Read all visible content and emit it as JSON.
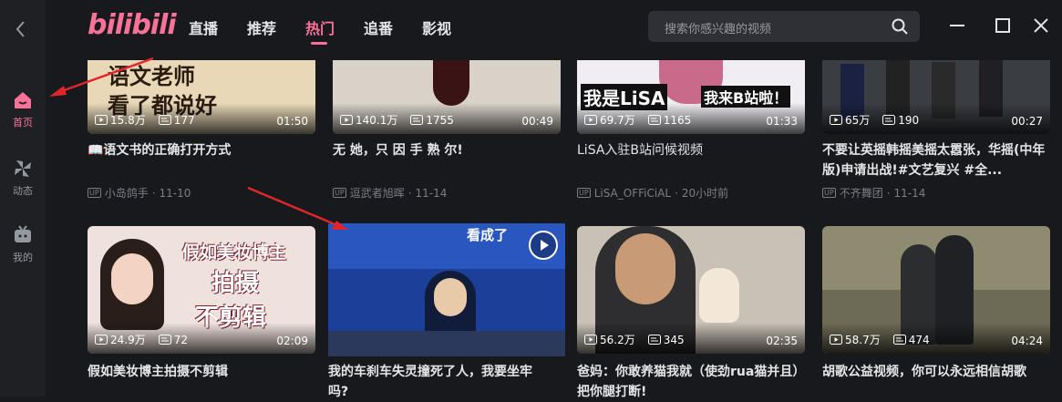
{
  "app": {
    "logo": "bilibili"
  },
  "sidebar": {
    "items": [
      {
        "label": "首页",
        "icon": "home-icon",
        "active": true
      },
      {
        "label": "动态",
        "icon": "pinwheel-icon",
        "active": false
      },
      {
        "label": "我的",
        "icon": "tv-icon",
        "active": false
      }
    ]
  },
  "nav": {
    "tabs": [
      {
        "label": "直播"
      },
      {
        "label": "推荐"
      },
      {
        "label": "热门"
      },
      {
        "label": "追番"
      },
      {
        "label": "影视"
      }
    ],
    "active_tab": "热门"
  },
  "search": {
    "placeholder": "搜索你感兴趣的视频"
  },
  "colors": {
    "accent": "#fb7299",
    "background": "#18191c",
    "sidebar": "#1f2023"
  },
  "videos": [
    {
      "views": "15.8万",
      "danmaku": "177",
      "duration": "01:50",
      "title": "📖语文书的正确打开方式",
      "author": "小岛鸽手",
      "date": "11-10",
      "thumb_text": "语文老师\n看了都说好"
    },
    {
      "views": "140.1万",
      "danmaku": "1755",
      "duration": "00:49",
      "title": "无 她，只 因 手 熟 尔!",
      "author": "逗武者旭晖",
      "date": "11-14"
    },
    {
      "views": "69.7万",
      "danmaku": "1165",
      "duration": "01:33",
      "title": "LiSA入驻B站问候视频",
      "author": "LiSA_OFFiCiAL",
      "date": "20小时前",
      "thumb_text_left": "我是LiSA",
      "thumb_text_right": "我来B站啦！"
    },
    {
      "views": "65万",
      "danmaku": "190",
      "duration": "00:27",
      "title": "不要让英摇韩摇美摇太嚣张，华摇(中年版)申请出战!#文艺复兴 #全...",
      "author": "不齐舞团",
      "date": "11-14"
    },
    {
      "views": "24.9万",
      "danmaku": "72",
      "duration": "02:09",
      "title": "假如美妆博主拍摄不剪辑",
      "thumb_text": [
        "假如美妆博主",
        "拍摄",
        "不剪辑"
      ]
    },
    {
      "views": "",
      "danmaku": "",
      "duration": "",
      "title": "我的车刹车失灵撞死了人，我要坐牢吗?",
      "thumb_text": "看成了"
    },
    {
      "views": "56.2万",
      "danmaku": "345",
      "duration": "02:35",
      "title": "爸妈：你敢养猫我就（使劲rua猫并且）把你腿打断!"
    },
    {
      "views": "58.7万",
      "danmaku": "474",
      "duration": "04:24",
      "title": "胡歌公益视频，你可以永远相信胡歌"
    }
  ]
}
